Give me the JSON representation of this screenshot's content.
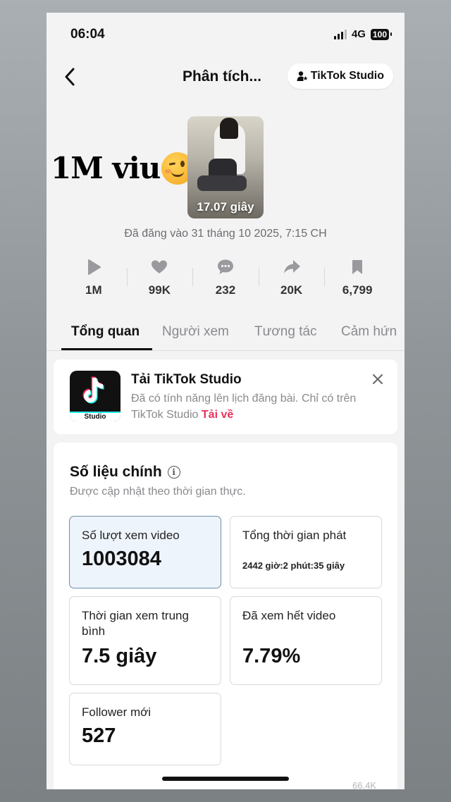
{
  "status_bar": {
    "time": "06:04",
    "network": "4G",
    "battery": "100"
  },
  "header": {
    "title": "Phân tích...",
    "studio_button": "TikTok Studio"
  },
  "overlay": {
    "caption": "1M viu"
  },
  "video": {
    "duration": "17.07 giây",
    "posted": "Đã đăng vào 31 tháng 10 2025, 7:15 CH"
  },
  "stats": [
    {
      "icon": "play-icon",
      "value": "1M"
    },
    {
      "icon": "heart-icon",
      "value": "99K"
    },
    {
      "icon": "comment-icon",
      "value": "232"
    },
    {
      "icon": "share-icon",
      "value": "20K"
    },
    {
      "icon": "bookmark-icon",
      "value": "6,799"
    }
  ],
  "tabs": [
    "Tổng quan",
    "Người xem",
    "Tương tác",
    "Cảm hứn"
  ],
  "promo": {
    "title": "Tải TikTok Studio",
    "description": "Đã có tính năng lên lịch đăng bài. Chỉ có trên TikTok Studio",
    "link": "Tải về",
    "logo_label": "Studio"
  },
  "metrics": {
    "title": "Số liệu chính",
    "subtitle": "Được cập nhật theo thời gian thực.",
    "items": [
      {
        "label": "Số lượt xem video",
        "value": "1003084"
      },
      {
        "label": "Tổng thời gian phát",
        "value": "2442 giờ:2 phút:35 giây"
      },
      {
        "label": "Thời gian xem trung bình",
        "value": "7.5 giây"
      },
      {
        "label": "Đã xem hết video",
        "value": "7.79%"
      },
      {
        "label": "Follower mới",
        "value": "527"
      }
    ]
  },
  "footer": {
    "ghost_text": "66.4K"
  },
  "colors": {
    "accent_link": "#e8325a",
    "active_box_bg": "#eef4fb"
  }
}
